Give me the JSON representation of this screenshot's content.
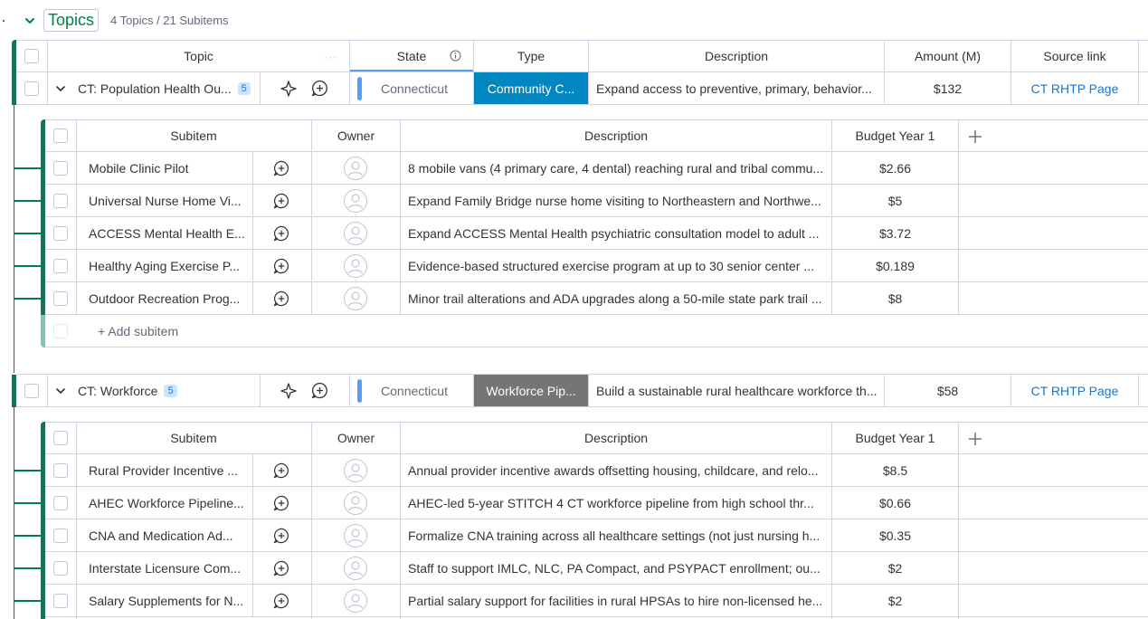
{
  "group": {
    "title": "Topics",
    "count_text": "4 Topics / 21 Subitems",
    "color": "#037f4c"
  },
  "columns": {
    "topic": "Topic",
    "state": "State",
    "type": "Type",
    "description": "Description",
    "amount": "Amount (M)",
    "source": "Source link"
  },
  "sub_columns": {
    "subitem": "Subitem",
    "owner": "Owner",
    "description": "Description",
    "budget": "Budget Year 1"
  },
  "topics": [
    {
      "name": "CT: Population Health Ou...",
      "sub_count": "5",
      "state": "Connecticut",
      "type": "Community C...",
      "type_color": "#0086c0",
      "description": "Expand access to preventive, primary, behavior...",
      "amount": "$132",
      "source": "CT RHTP Page",
      "subitems": [
        {
          "name": "Mobile Clinic Pilot",
          "description": "8 mobile vans (4 primary care, 4 dental) reaching rural and tribal commu...",
          "budget": "$2.66"
        },
        {
          "name": "Universal Nurse Home Vi...",
          "description": "Expand Family Bridge nurse home visiting to Northeastern and Northwe...",
          "budget": "$5"
        },
        {
          "name": "ACCESS Mental Health E...",
          "description": "Expand ACCESS Mental Health psychiatric consultation model to adult ...",
          "budget": "$3.72"
        },
        {
          "name": "Healthy Aging Exercise P...",
          "description": "Evidence-based structured exercise program at up to 30 senior center ...",
          "budget": "$0.189"
        },
        {
          "name": "Outdoor Recreation Prog...",
          "description": "Minor trail alterations and ADA upgrades along a 50-mile state park trail ...",
          "budget": "$8"
        }
      ],
      "add_subitem": "+ Add subitem"
    },
    {
      "name": "CT: Workforce",
      "sub_count": "5",
      "state": "Connecticut",
      "type": "Workforce Pip...",
      "type_color": "#757575",
      "description": "Build a sustainable rural healthcare workforce th...",
      "amount": "$58",
      "source": "CT RHTP Page",
      "subitems": [
        {
          "name": "Rural Provider Incentive ...",
          "description": "Annual provider incentive awards offsetting housing, childcare, and relo...",
          "budget": "$8.5"
        },
        {
          "name": "AHEC Workforce Pipeline...",
          "description": "AHEC-led 5-year STITCH 4 CT workforce pipeline from high school thr...",
          "budget": "$0.66"
        },
        {
          "name": "CNA and Medication Ad...",
          "description": "Formalize CNA training across all healthcare settings (not just nursing h...",
          "budget": "$0.35"
        },
        {
          "name": "Interstate Licensure Com...",
          "description": "Staff to support IMLC, NLC, PA Compact, and PSYPACT enrollment; ou...",
          "budget": "$2"
        },
        {
          "name": "Salary Supplements for N...",
          "description": "Partial salary support for facilities in rural HPSAs to hire non-licensed he...",
          "budget": "$2"
        }
      ]
    }
  ]
}
